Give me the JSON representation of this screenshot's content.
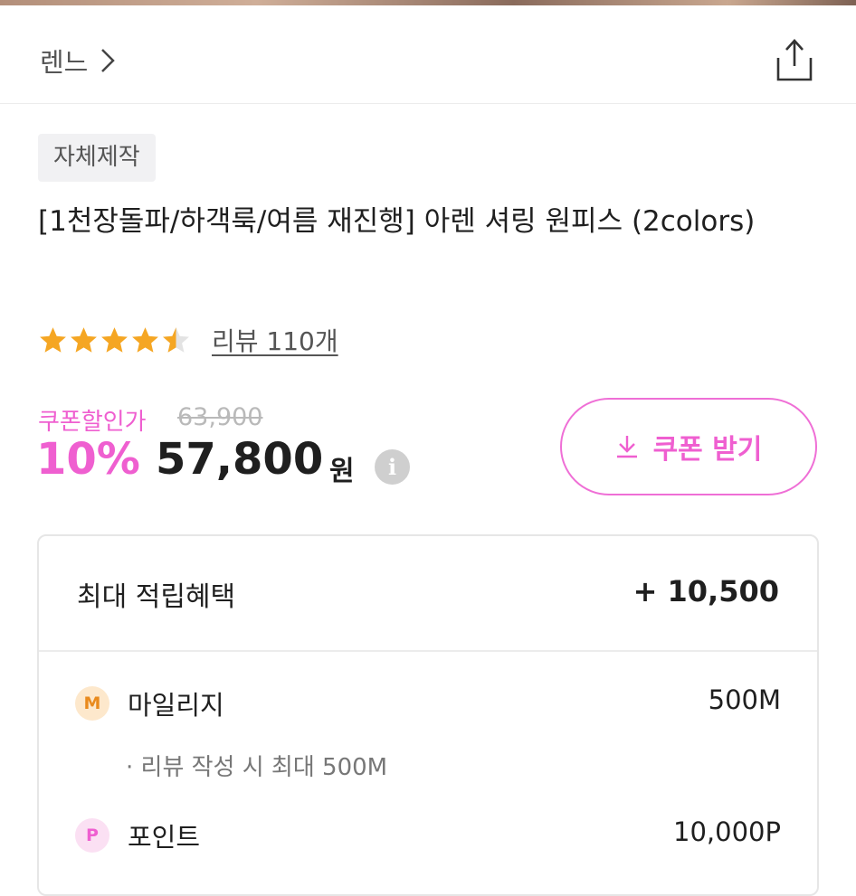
{
  "header": {
    "brand": "렌느",
    "chevron": "›",
    "share_icon": "share-icon"
  },
  "product": {
    "tag": "자체제작",
    "title": "[1천장돌파/하객룩/여름 재진행] 아렌 셔링 원피스 (2colors)",
    "rating": 4.5,
    "review_link": "리뷰 110개"
  },
  "price": {
    "coupon_label": "쿠폰할인가",
    "original": "63,900",
    "discount": "10%",
    "final": "57,800",
    "currency": "원",
    "info_icon": "i"
  },
  "coupon_button": {
    "label": "쿠폰 받기",
    "icon": "download-icon"
  },
  "rewards": {
    "title": "최대 적립혜택",
    "total": "+ 10,500",
    "mileage": {
      "badge": "M",
      "label": "마일리지",
      "value": "500M",
      "note": "리뷰 작성 시 최대 500M"
    },
    "point": {
      "badge": "P",
      "label": "포인트",
      "value": "10,000P"
    }
  },
  "colors": {
    "accent": "#ef5fd0",
    "star": "#f5a623",
    "mileage_badge_bg": "#fde8cc",
    "point_badge_bg": "#fbe0f3"
  }
}
